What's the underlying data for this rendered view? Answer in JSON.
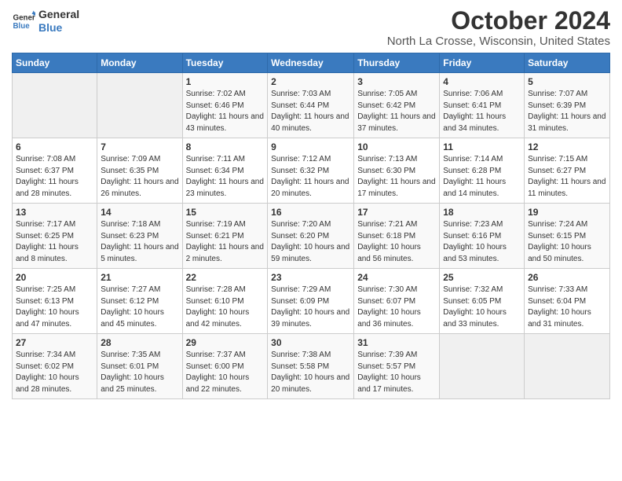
{
  "logo": {
    "line1": "General",
    "line2": "Blue"
  },
  "title": "October 2024",
  "location": "North La Crosse, Wisconsin, United States",
  "days_of_week": [
    "Sunday",
    "Monday",
    "Tuesday",
    "Wednesday",
    "Thursday",
    "Friday",
    "Saturday"
  ],
  "weeks": [
    [
      {
        "day": "",
        "info": ""
      },
      {
        "day": "",
        "info": ""
      },
      {
        "day": "1",
        "info": "Sunrise: 7:02 AM\nSunset: 6:46 PM\nDaylight: 11 hours and 43 minutes."
      },
      {
        "day": "2",
        "info": "Sunrise: 7:03 AM\nSunset: 6:44 PM\nDaylight: 11 hours and 40 minutes."
      },
      {
        "day": "3",
        "info": "Sunrise: 7:05 AM\nSunset: 6:42 PM\nDaylight: 11 hours and 37 minutes."
      },
      {
        "day": "4",
        "info": "Sunrise: 7:06 AM\nSunset: 6:41 PM\nDaylight: 11 hours and 34 minutes."
      },
      {
        "day": "5",
        "info": "Sunrise: 7:07 AM\nSunset: 6:39 PM\nDaylight: 11 hours and 31 minutes."
      }
    ],
    [
      {
        "day": "6",
        "info": "Sunrise: 7:08 AM\nSunset: 6:37 PM\nDaylight: 11 hours and 28 minutes."
      },
      {
        "day": "7",
        "info": "Sunrise: 7:09 AM\nSunset: 6:35 PM\nDaylight: 11 hours and 26 minutes."
      },
      {
        "day": "8",
        "info": "Sunrise: 7:11 AM\nSunset: 6:34 PM\nDaylight: 11 hours and 23 minutes."
      },
      {
        "day": "9",
        "info": "Sunrise: 7:12 AM\nSunset: 6:32 PM\nDaylight: 11 hours and 20 minutes."
      },
      {
        "day": "10",
        "info": "Sunrise: 7:13 AM\nSunset: 6:30 PM\nDaylight: 11 hours and 17 minutes."
      },
      {
        "day": "11",
        "info": "Sunrise: 7:14 AM\nSunset: 6:28 PM\nDaylight: 11 hours and 14 minutes."
      },
      {
        "day": "12",
        "info": "Sunrise: 7:15 AM\nSunset: 6:27 PM\nDaylight: 11 hours and 11 minutes."
      }
    ],
    [
      {
        "day": "13",
        "info": "Sunrise: 7:17 AM\nSunset: 6:25 PM\nDaylight: 11 hours and 8 minutes."
      },
      {
        "day": "14",
        "info": "Sunrise: 7:18 AM\nSunset: 6:23 PM\nDaylight: 11 hours and 5 minutes."
      },
      {
        "day": "15",
        "info": "Sunrise: 7:19 AM\nSunset: 6:21 PM\nDaylight: 11 hours and 2 minutes."
      },
      {
        "day": "16",
        "info": "Sunrise: 7:20 AM\nSunset: 6:20 PM\nDaylight: 10 hours and 59 minutes."
      },
      {
        "day": "17",
        "info": "Sunrise: 7:21 AM\nSunset: 6:18 PM\nDaylight: 10 hours and 56 minutes."
      },
      {
        "day": "18",
        "info": "Sunrise: 7:23 AM\nSunset: 6:16 PM\nDaylight: 10 hours and 53 minutes."
      },
      {
        "day": "19",
        "info": "Sunrise: 7:24 AM\nSunset: 6:15 PM\nDaylight: 10 hours and 50 minutes."
      }
    ],
    [
      {
        "day": "20",
        "info": "Sunrise: 7:25 AM\nSunset: 6:13 PM\nDaylight: 10 hours and 47 minutes."
      },
      {
        "day": "21",
        "info": "Sunrise: 7:27 AM\nSunset: 6:12 PM\nDaylight: 10 hours and 45 minutes."
      },
      {
        "day": "22",
        "info": "Sunrise: 7:28 AM\nSunset: 6:10 PM\nDaylight: 10 hours and 42 minutes."
      },
      {
        "day": "23",
        "info": "Sunrise: 7:29 AM\nSunset: 6:09 PM\nDaylight: 10 hours and 39 minutes."
      },
      {
        "day": "24",
        "info": "Sunrise: 7:30 AM\nSunset: 6:07 PM\nDaylight: 10 hours and 36 minutes."
      },
      {
        "day": "25",
        "info": "Sunrise: 7:32 AM\nSunset: 6:05 PM\nDaylight: 10 hours and 33 minutes."
      },
      {
        "day": "26",
        "info": "Sunrise: 7:33 AM\nSunset: 6:04 PM\nDaylight: 10 hours and 31 minutes."
      }
    ],
    [
      {
        "day": "27",
        "info": "Sunrise: 7:34 AM\nSunset: 6:02 PM\nDaylight: 10 hours and 28 minutes."
      },
      {
        "day": "28",
        "info": "Sunrise: 7:35 AM\nSunset: 6:01 PM\nDaylight: 10 hours and 25 minutes."
      },
      {
        "day": "29",
        "info": "Sunrise: 7:37 AM\nSunset: 6:00 PM\nDaylight: 10 hours and 22 minutes."
      },
      {
        "day": "30",
        "info": "Sunrise: 7:38 AM\nSunset: 5:58 PM\nDaylight: 10 hours and 20 minutes."
      },
      {
        "day": "31",
        "info": "Sunrise: 7:39 AM\nSunset: 5:57 PM\nDaylight: 10 hours and 17 minutes."
      },
      {
        "day": "",
        "info": ""
      },
      {
        "day": "",
        "info": ""
      }
    ]
  ]
}
